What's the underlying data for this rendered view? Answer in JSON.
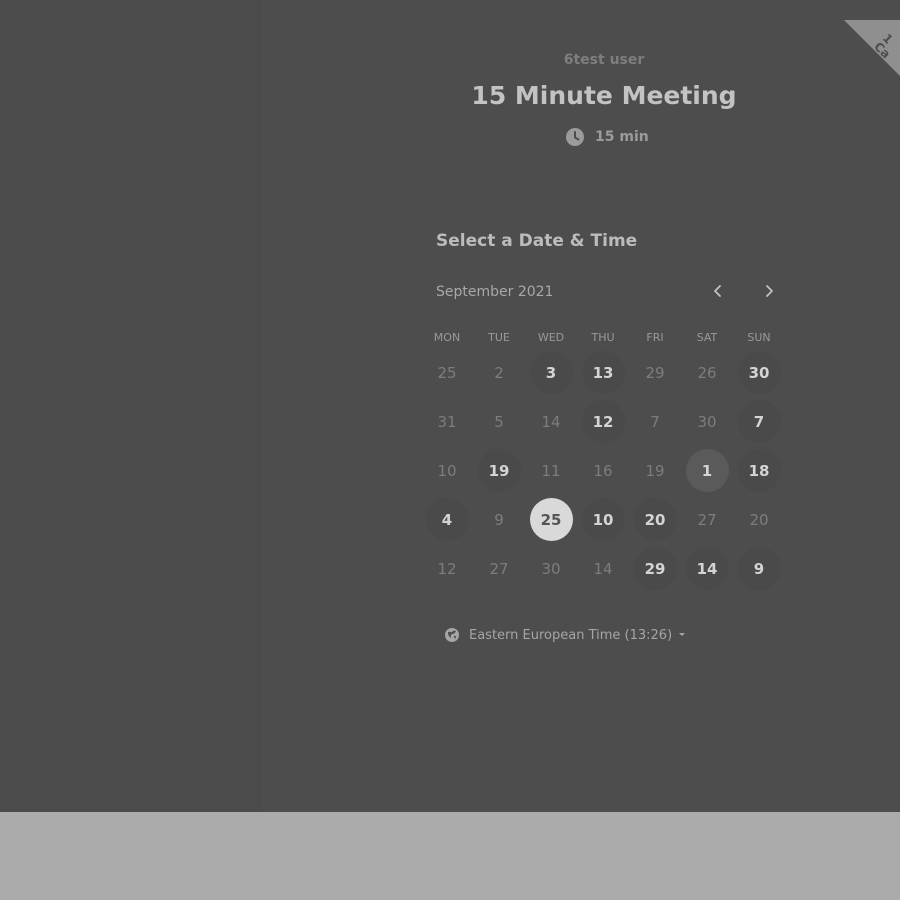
{
  "app": {
    "corner_ribbon": {
      "lines": [
        "1",
        "Ca"
      ]
    }
  },
  "event": {
    "host": "6test user",
    "title": "15 Minute Meeting",
    "duration": "15 min",
    "duration_icon": "clock-icon"
  },
  "scheduler": {
    "section_title": "Select a Date & Time",
    "month": "September 2021",
    "prev_icon": "chevron-left-icon",
    "next_icon": "chevron-right-icon",
    "weekdays": [
      "MON",
      "TUE",
      "WED",
      "THU",
      "FRI",
      "SAT",
      "SUN"
    ],
    "days": [
      {
        "label": "25",
        "state": "unavailable"
      },
      {
        "label": "2",
        "state": "unavailable"
      },
      {
        "label": "3",
        "state": "available"
      },
      {
        "label": "13",
        "state": "available"
      },
      {
        "label": "29",
        "state": "unavailable"
      },
      {
        "label": "26",
        "state": "unavailable"
      },
      {
        "label": "30",
        "state": "available"
      },
      {
        "label": "31",
        "state": "unavailable"
      },
      {
        "label": "5",
        "state": "unavailable"
      },
      {
        "label": "14",
        "state": "unavailable"
      },
      {
        "label": "12",
        "state": "available"
      },
      {
        "label": "7",
        "state": "unavailable"
      },
      {
        "label": "30",
        "state": "unavailable"
      },
      {
        "label": "7",
        "state": "available"
      },
      {
        "label": "10",
        "state": "unavailable"
      },
      {
        "label": "19",
        "state": "available"
      },
      {
        "label": "11",
        "state": "unavailable"
      },
      {
        "label": "16",
        "state": "unavailable"
      },
      {
        "label": "19",
        "state": "unavailable"
      },
      {
        "label": "1",
        "state": "highlighted"
      },
      {
        "label": "18",
        "state": "available"
      },
      {
        "label": "4",
        "state": "available"
      },
      {
        "label": "9",
        "state": "unavailable"
      },
      {
        "label": "25",
        "state": "selected"
      },
      {
        "label": "10",
        "state": "available"
      },
      {
        "label": "20",
        "state": "available"
      },
      {
        "label": "27",
        "state": "unavailable"
      },
      {
        "label": "20",
        "state": "unavailable"
      },
      {
        "label": "12",
        "state": "unavailable"
      },
      {
        "label": "27",
        "state": "unavailable"
      },
      {
        "label": "30",
        "state": "unavailable"
      },
      {
        "label": "14",
        "state": "unavailable"
      },
      {
        "label": "29",
        "state": "available"
      },
      {
        "label": "14",
        "state": "available"
      },
      {
        "label": "9",
        "state": "available"
      }
    ],
    "timezone": "Eastern European Time (13:26)",
    "timezone_icon": "globe-icon",
    "timezone_caret_icon": "caret-down-icon"
  },
  "colors": {
    "overlay": "#4d4d4d",
    "footer": "#ababab",
    "selected_day": "#d9d9d9",
    "available_day": "#4a4a4a"
  }
}
